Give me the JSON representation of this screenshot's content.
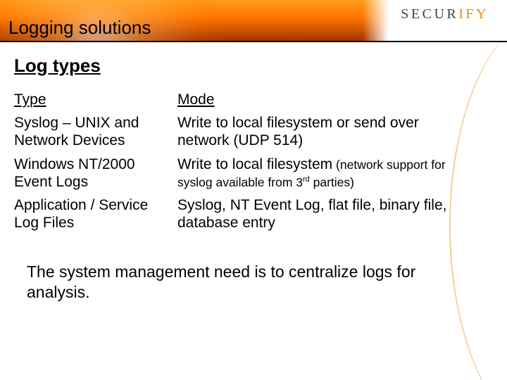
{
  "brand": {
    "part1": "SECUR",
    "part2": "IFY"
  },
  "title": "Logging solutions",
  "subtitle": "Log types",
  "table": {
    "head": {
      "type": "Type",
      "mode": "Mode"
    },
    "rows": [
      {
        "type": "Syslog – UNIX and Network Devices",
        "mode": "Write to local filesystem or send over network (UDP 514)"
      },
      {
        "type": "Windows NT/2000 Event Logs",
        "mode": "Write to local filesystem",
        "mode_note_pre": " (network support for syslog available from 3",
        "mode_note_sup": "rd",
        "mode_note_post": " parties)"
      },
      {
        "type": "Application / Service Log Files",
        "mode": "Syslog, NT Event Log, flat file, binary file, database entry"
      }
    ]
  },
  "footer": "The system management need is to centralize logs for analysis."
}
